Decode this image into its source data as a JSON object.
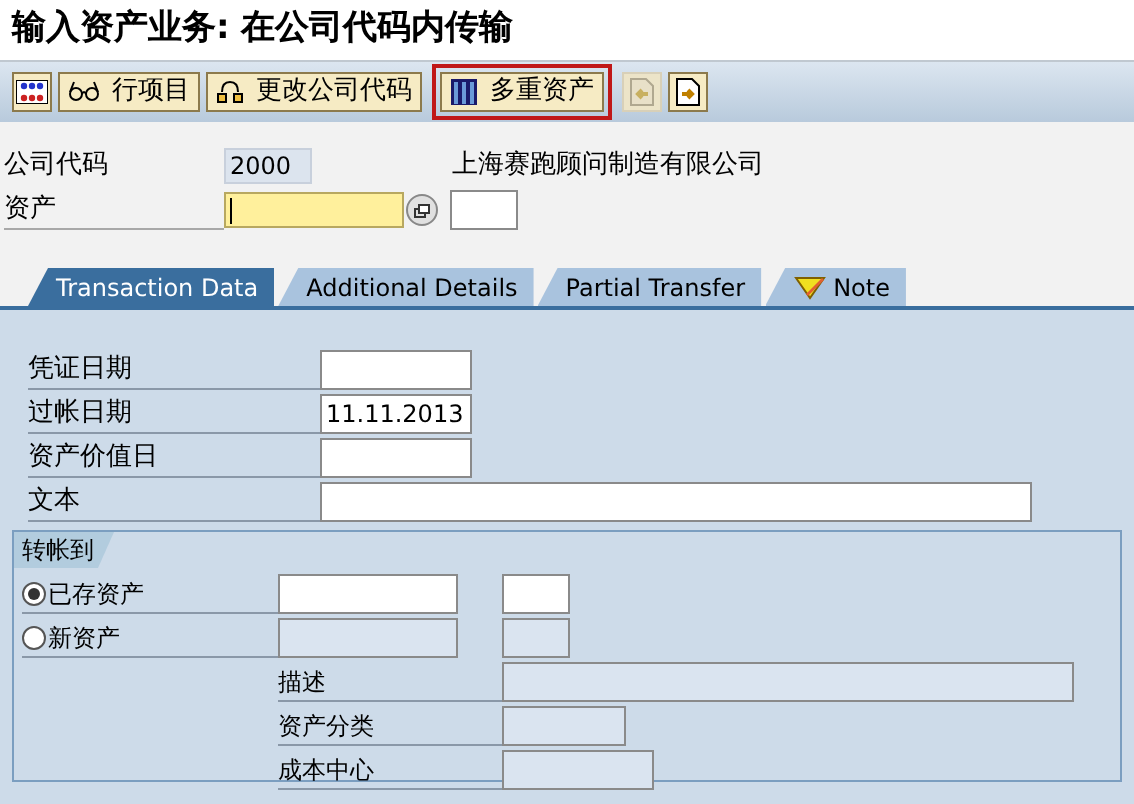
{
  "window": {
    "title": "输入资产业务: 在公司代码内传输"
  },
  "toolbar": [
    {
      "kind": "icon",
      "disabled": false,
      "highlighted": false
    },
    {
      "kind": "text",
      "label": "行项目",
      "disabled": false,
      "highlighted": false
    },
    {
      "kind": "text",
      "label": "更改公司代码",
      "disabled": false,
      "highlighted": false
    },
    {
      "kind": "text",
      "label": "多重资产",
      "disabled": false,
      "highlighted": true
    },
    {
      "kind": "icon",
      "disabled": true,
      "highlighted": false
    },
    {
      "kind": "icon",
      "disabled": false,
      "highlighted": false
    }
  ],
  "header": {
    "company_code": {
      "label": "公司代码",
      "value": "2000",
      "name": "上海赛跑顾问制造有限公司"
    },
    "asset": {
      "label": "资产",
      "focused": true
    }
  },
  "tabs": [
    {
      "label": "Transaction Data",
      "selected": true
    },
    {
      "label": "Additional Details",
      "selected": false
    },
    {
      "label": "Partial Transfer",
      "selected": false
    },
    {
      "label": "Note",
      "selected": false,
      "kind": "note"
    }
  ],
  "fields": [
    {
      "label": "凭证日期"
    },
    {
      "label": "过帐日期",
      "value": "11.11.2013"
    },
    {
      "label": "资产价值日"
    },
    {
      "label": "文本"
    }
  ],
  "transfer": {
    "title": "转帐到",
    "options": [
      {
        "label": "已存资产",
        "selected": true
      },
      {
        "label": "新资产",
        "selected": false
      }
    ],
    "details": [
      {
        "label": "描述"
      },
      {
        "label": "资产分类"
      },
      {
        "label": "成本中心"
      }
    ]
  }
}
